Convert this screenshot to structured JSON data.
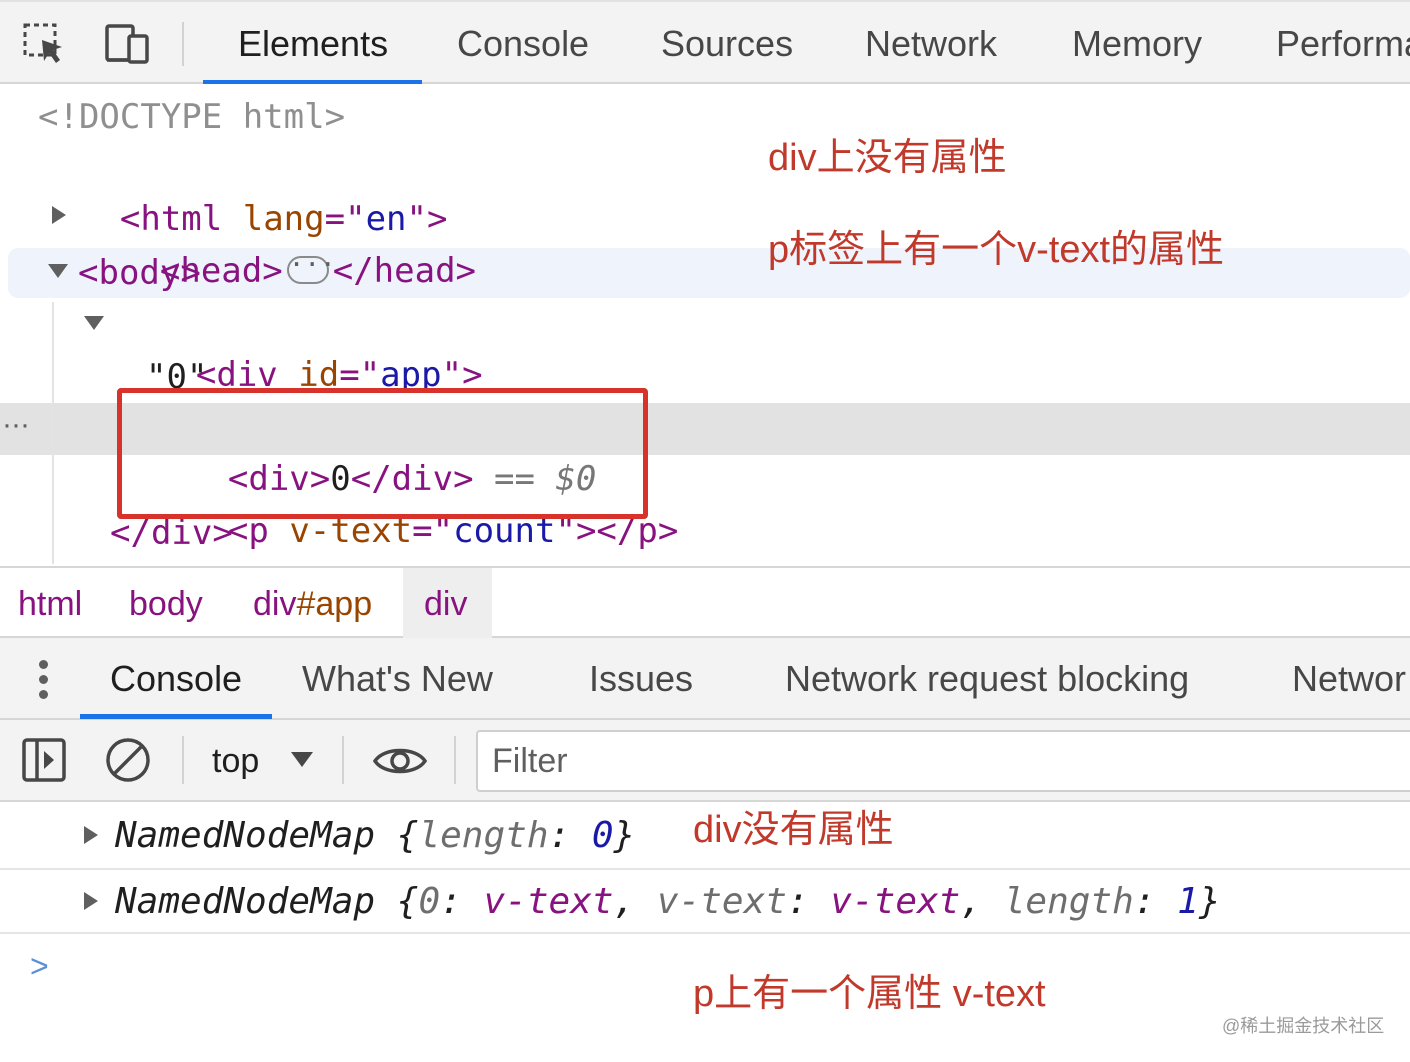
{
  "toolbar": {
    "tabs": [
      "Elements",
      "Console",
      "Sources",
      "Network",
      "Memory",
      "Performa"
    ],
    "icons": [
      "inspect-element-icon",
      "device-toolbar-icon"
    ]
  },
  "elements": {
    "doctype": "<!DOCTYPE html>",
    "html_open": "<html",
    "html_attr_name": "lang",
    "html_attr_eq": "=\"",
    "html_attr_value": "en",
    "html_close_bracket": "\">",
    "head_open": "<head>",
    "head_ellipsis": "···",
    "head_close": "</head>",
    "body_open": "<body>",
    "div_open": "<div",
    "div_attr_name": "id",
    "div_attr_eq": "=\"",
    "div_attr_value": "app",
    "div_close_bracket": "\">",
    "text_node": "\"0\"",
    "selected_open": "<div>",
    "selected_text": "0",
    "selected_close": "</div>",
    "selected_marker": " == $0",
    "p_open": "<p",
    "p_attr_name": "v-text",
    "p_attr_eq": "=\"",
    "p_attr_value": "count",
    "p_close": "\"></p>",
    "div_end": "</div>",
    "row_menu": "···"
  },
  "annotations": {
    "a1": "div上没有属性",
    "a2": "p标签上有一个v-text的属性",
    "a3": "div没有属性",
    "a4": "p上有一个属性 v-text"
  },
  "breadcrumb": {
    "items": [
      "html",
      "body",
      "div",
      "#app",
      "div"
    ]
  },
  "drawer": {
    "tabs": [
      "Console",
      "What's New",
      "Issues",
      "Network request blocking",
      "Networ"
    ]
  },
  "console_toolbar": {
    "context": "top",
    "filter_placeholder": "Filter"
  },
  "console_output": {
    "row1": {
      "name": "NamedNodeMap ",
      "open": "{",
      "key": "length",
      "colon": ": ",
      "value": "0",
      "close": "}"
    },
    "row2": {
      "name": "NamedNodeMap ",
      "open": "{",
      "k0": "0",
      "colon": ": ",
      "v0": "v-text",
      "comma": ", ",
      "k1": "v-text",
      "v1": "v-text",
      "k2": "length",
      "v2": "1",
      "close": "}"
    },
    "prompt": ">"
  },
  "watermark": "@稀土掘金技术社区",
  "colors": {
    "accent": "#1a73e8",
    "annotation_red": "#d7332a",
    "tag": "#881280",
    "attr": "#994500",
    "value": "#1a1aa6"
  }
}
